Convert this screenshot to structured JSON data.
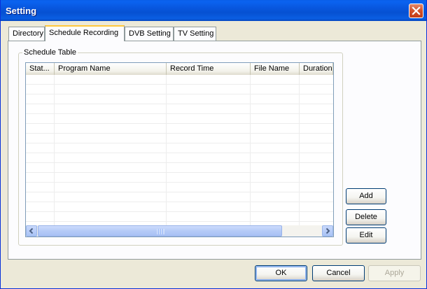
{
  "window": {
    "title": "Setting"
  },
  "tabs": [
    {
      "label": "Directory",
      "active": false
    },
    {
      "label": "Schedule Recording",
      "active": true
    },
    {
      "label": "DVB Setting",
      "active": false
    },
    {
      "label": "TV Setting",
      "active": false
    }
  ],
  "schedule": {
    "group_label": "Schedule Table",
    "columns": [
      "Stat...",
      "Program Name",
      "Record Time",
      "File Name",
      "Duration"
    ],
    "rows": [],
    "buttons": {
      "add": "Add",
      "delete": "Delete",
      "edit": "Edit"
    }
  },
  "footer": {
    "ok": "OK",
    "cancel": "Cancel",
    "apply": "Apply"
  },
  "icons": {
    "close": "close-icon",
    "scroll_left": "arrow-left-icon",
    "scroll_right": "arrow-right-icon",
    "grip": "scroll-grip-icon"
  },
  "colors": {
    "titlebar": "#0a5ee8",
    "window_bg": "#ece9d8",
    "tab_accent": "#ffc83c"
  }
}
